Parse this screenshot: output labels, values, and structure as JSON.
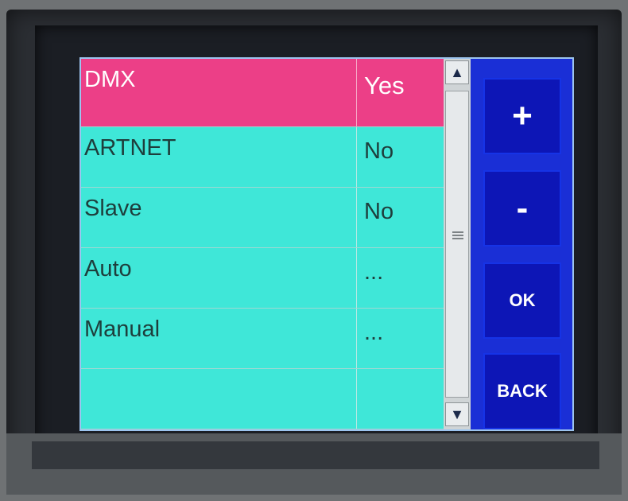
{
  "rows": [
    {
      "label": "DMX",
      "value": "Yes",
      "selected": true
    },
    {
      "label": "ARTNET",
      "value": "No",
      "selected": false
    },
    {
      "label": "Slave",
      "value": "No",
      "selected": false
    },
    {
      "label": "Auto",
      "value": "...",
      "selected": false
    },
    {
      "label": "Manual",
      "value": "...",
      "selected": false
    },
    {
      "label": "",
      "value": "",
      "selected": false
    }
  ],
  "buttons": {
    "plus": "+",
    "minus": "-",
    "ok": "OK",
    "back": "BACK"
  },
  "scrollbar": {
    "up_icon": "▲",
    "down_icon": "▼"
  },
  "colors": {
    "selected_row": "#ec3f87",
    "row": "#3fe7d8",
    "button": "#0d16b6",
    "screen_bg": "#1a2fd6"
  }
}
